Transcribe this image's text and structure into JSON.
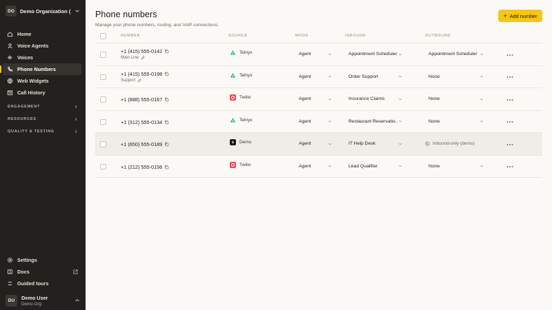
{
  "org": {
    "initials": "DO",
    "name": "Demo Organization (..."
  },
  "nav": [
    {
      "label": "Home",
      "icon": "home-icon"
    },
    {
      "label": "Voice Agents",
      "icon": "user-icon"
    },
    {
      "label": "Voices",
      "icon": "waveform-icon"
    },
    {
      "label": "Phone Numbers",
      "icon": "phone-icon",
      "active": true
    },
    {
      "label": "Web Widgets",
      "icon": "globe-icon"
    },
    {
      "label": "Call History",
      "icon": "history-icon"
    }
  ],
  "sections": [
    "ENGAGEMENT",
    "RESOURCES",
    "QUALITY & TESTING"
  ],
  "bottom_nav": [
    {
      "label": "Settings",
      "icon": "gear-icon"
    },
    {
      "label": "Docs",
      "icon": "book-icon"
    },
    {
      "label": "Guided tours",
      "icon": "tour-icon"
    }
  ],
  "user": {
    "initials": "DU",
    "name": "Demo User",
    "org": "Demo Org"
  },
  "page": {
    "title": "Phone numbers",
    "subtitle": "Manage your phone numbers, routing, and VoIP connections.",
    "add_label": "Add number"
  },
  "table": {
    "headers": {
      "number": "NUMBER",
      "source": "SOURCE",
      "mode": "MODE",
      "inbound": "INBOUND",
      "outbound": "OUTBOUND"
    },
    "rows": [
      {
        "number": "+1 (415) 555-0142",
        "label": "Main Line",
        "source": "Telnyx",
        "mode": "Agent",
        "inbound": "Appointment Scheduler",
        "outbound": "Appointment Scheduler",
        "outbound_type": "select",
        "highlight": false
      },
      {
        "number": "+1 (415) 555-0198",
        "label": "Support",
        "source": "Telnyx",
        "mode": "Agent",
        "inbound": "Order Support",
        "outbound": "None",
        "outbound_type": "select",
        "highlight": false
      },
      {
        "number": "+1 (888) 555-0167",
        "label": "",
        "source": "Twilio",
        "mode": "Agent",
        "inbound": "Insurance Claims",
        "outbound": "None",
        "outbound_type": "select",
        "highlight": false
      },
      {
        "number": "+1 (312) 555-0134",
        "label": "",
        "source": "Telnyx",
        "mode": "Agent",
        "inbound": "Restaurant Reservatio...",
        "outbound": "None",
        "outbound_type": "select",
        "highlight": false
      },
      {
        "number": "+1 (650) 555-0189",
        "label": "",
        "source": "Demo",
        "mode": "Agent",
        "inbound": "IT Help Desk",
        "outbound": "Inbound-only (demo)",
        "outbound_type": "note",
        "highlight": true
      },
      {
        "number": "+1 (212) 555-0156",
        "label": "",
        "source": "Twilio",
        "mode": "Agent",
        "inbound": "Lead Qualifier",
        "outbound": "None",
        "outbound_type": "select",
        "highlight": false
      }
    ]
  },
  "colors": {
    "accent": "#f5c518",
    "sidebar": "#22211e",
    "telnyx": "#1fbf83",
    "twilio": "#e8424d",
    "demo": "#1a1815"
  }
}
